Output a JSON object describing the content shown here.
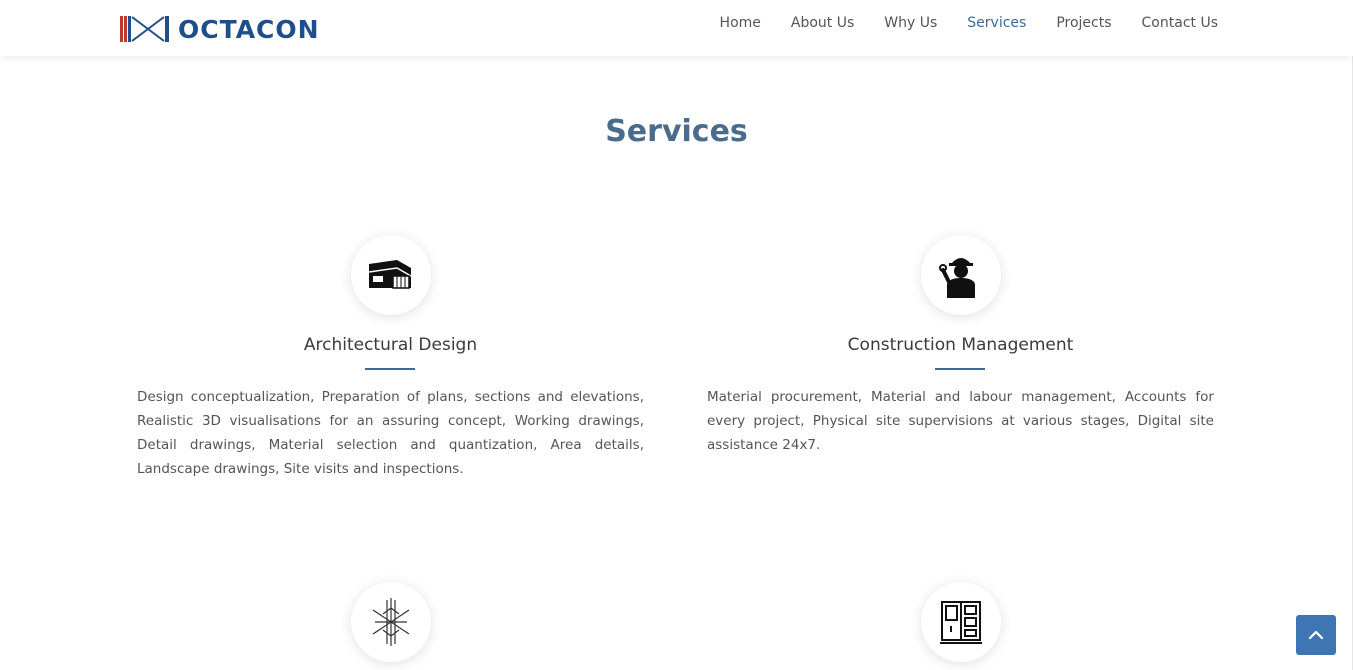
{
  "brand": {
    "name": "OCTACON",
    "color": "#1f4f8a",
    "accent": "#c0392b"
  },
  "nav": {
    "items": [
      {
        "label": "Home"
      },
      {
        "label": "About Us"
      },
      {
        "label": "Why Us"
      },
      {
        "label": "Services",
        "active": true
      },
      {
        "label": "Projects"
      },
      {
        "label": "Contact Us"
      }
    ]
  },
  "section": {
    "title": "Services"
  },
  "services": [
    {
      "icon": "building-icon",
      "title": "Architectural Design",
      "description": "Design conceptualization, Preparation of plans, sections and elevations, Realistic 3D visualisations for an assuring concept, Working drawings, Detail drawings, Material selection and quantization, Area details, Landscape drawings, Site visits and inspections."
    },
    {
      "icon": "construction-worker-icon",
      "title": "Construction Management",
      "description": "Material procurement, Material and labour management, Accounts for every project, Physical site supervisions at various stages, Digital site assistance 24x7."
    },
    {
      "icon": "structure-icon"
    },
    {
      "icon": "interior-cabinet-icon"
    }
  ],
  "colors": {
    "title": "#4a6b8c",
    "underline": "#3d6a9a",
    "back_to_top": "#3d76b3"
  },
  "back_to_top": {
    "icon": "chevron-up-icon"
  }
}
